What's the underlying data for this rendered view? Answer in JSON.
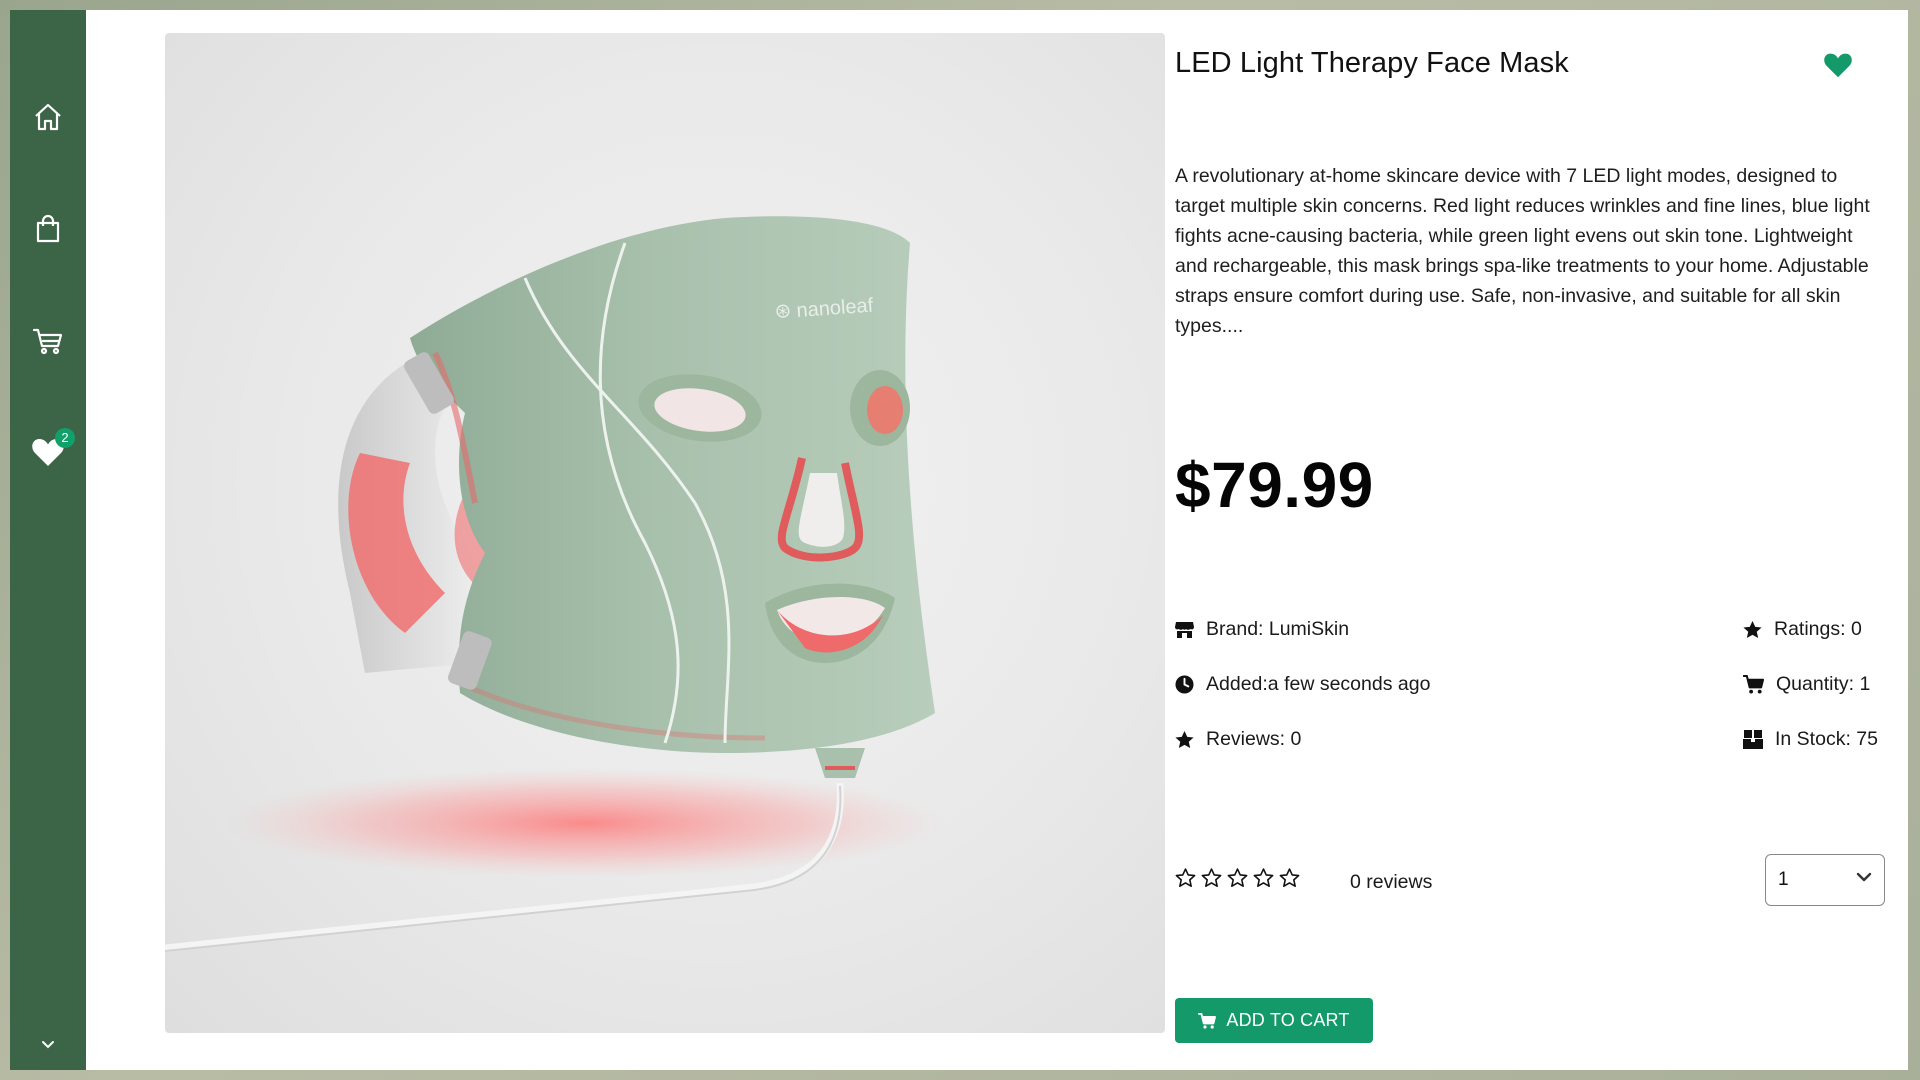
{
  "sidebar": {
    "items": [
      {
        "icon": "home-icon",
        "label": "Home"
      },
      {
        "icon": "shopping-bag-icon",
        "label": "Shop"
      },
      {
        "icon": "cart-icon",
        "label": "Cart"
      },
      {
        "icon": "heart-icon",
        "label": "Wishlist",
        "badge": "2"
      }
    ],
    "expand_icon": "chevron-down-icon"
  },
  "product": {
    "title": "LED Light Therapy Face Mask",
    "image_brand_text": "nanoleaf",
    "description": "A revolutionary at-home skincare device with 7 LED light modes, designed to target multiple skin concerns. Red light reduces wrinkles and fine lines, blue light fights acne-causing bacteria, while green light evens out skin tone. Lightweight and rechargeable, this mask brings spa-like treatments to your home. Adjustable straps ensure comfort during use. Safe, non-invasive, and suitable for all skin types....",
    "price": "$79.99",
    "brand": "Brand: LumiSkin",
    "added": "Added:a few seconds ago",
    "reviews": "Reviews: 0",
    "ratings": "Ratings: 0",
    "quantity": "Quantity: 1",
    "in_stock": "In Stock: 75",
    "rating_value": 0,
    "rating_max": 5,
    "review_count_text": "0 reviews",
    "selected_qty": "1",
    "add_to_cart_label": "ADD TO CART"
  },
  "colors": {
    "sidebar": "#3c6446",
    "accent": "#14996a",
    "badge": "#10a06a"
  }
}
